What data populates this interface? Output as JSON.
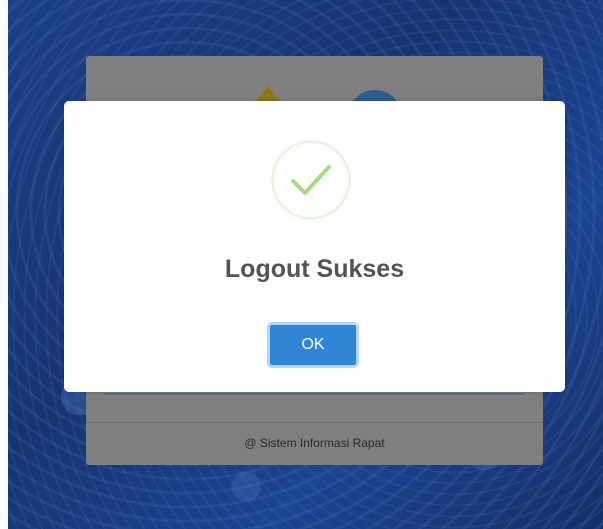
{
  "dialog": {
    "title": "Logout Sukses",
    "icon": "success-check-icon",
    "confirm_label": "OK"
  },
  "login_panel": {
    "footer_text": "@ Sistem Informasi Rapat"
  },
  "colors": {
    "background": "#1b3f86",
    "overlay_panel": "#7f7f7f",
    "success_green": "#a5dc86",
    "confirm_button": "#3085d6",
    "title_text": "#545454"
  }
}
